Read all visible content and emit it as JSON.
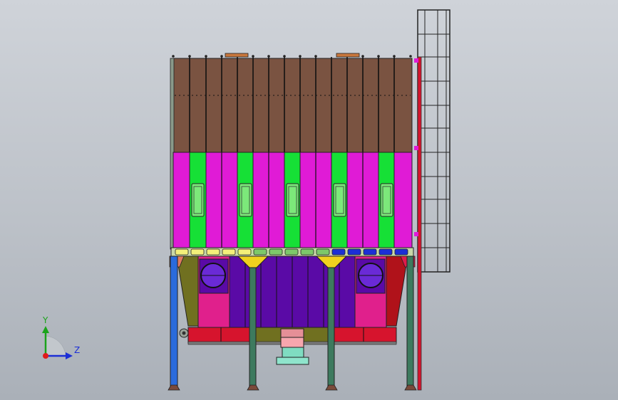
{
  "viewport": {
    "model": "dust-collector-assembly",
    "colors": {
      "roof_brown": "#7a5341",
      "magenta": "#e01bd6",
      "green": "#16e036",
      "purple": "#5a0aa6",
      "pink": "#e0208c",
      "red": "#d6142d",
      "olive": "#707020",
      "blue": "#2a6bdc",
      "teal": "#3d7a5e",
      "yellow": "#f0d21e",
      "dark_red": "#b0121a"
    }
  },
  "triad": {
    "y_label": "Y",
    "z_label": "Z"
  }
}
